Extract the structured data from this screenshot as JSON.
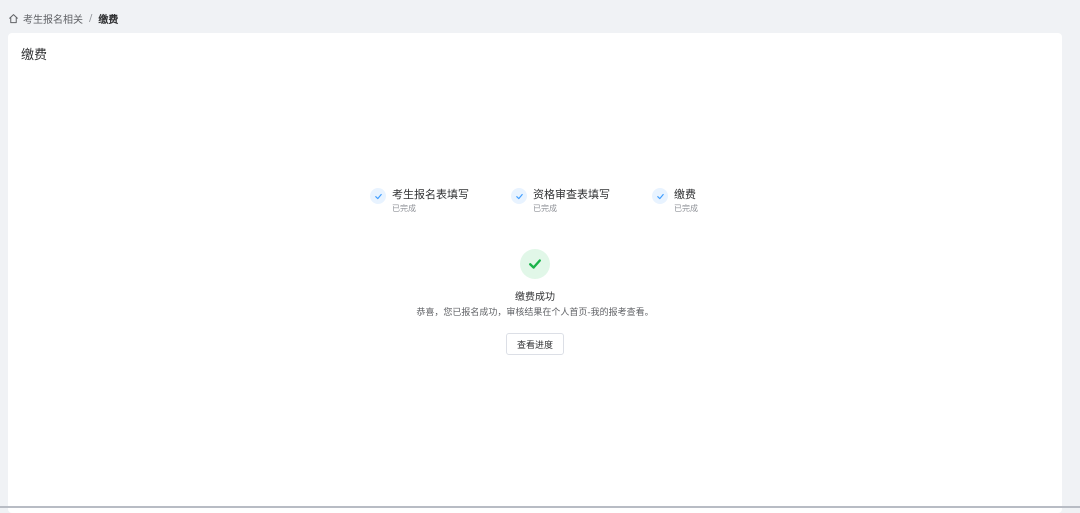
{
  "breadcrumb": {
    "parent": "考生报名相关",
    "separator": "/",
    "current": "缴费"
  },
  "page": {
    "title": "缴费"
  },
  "steps": [
    {
      "title": "考生报名表填写",
      "desc": "已完成"
    },
    {
      "title": "资格审查表填写",
      "desc": "已完成"
    },
    {
      "title": "缴费",
      "desc": "已完成"
    }
  ],
  "result": {
    "title": "缴费成功",
    "subtitle": "恭喜，您已报名成功，审核结果在个人首页-我的报考查看。",
    "button_label": "查看进度"
  },
  "colors": {
    "accent": "#409eff",
    "success": "#1ab34a",
    "background": "#f0f2f5"
  },
  "icons": {
    "breadcrumb": "home-icon",
    "step": "check-icon",
    "result": "success-check-icon"
  }
}
